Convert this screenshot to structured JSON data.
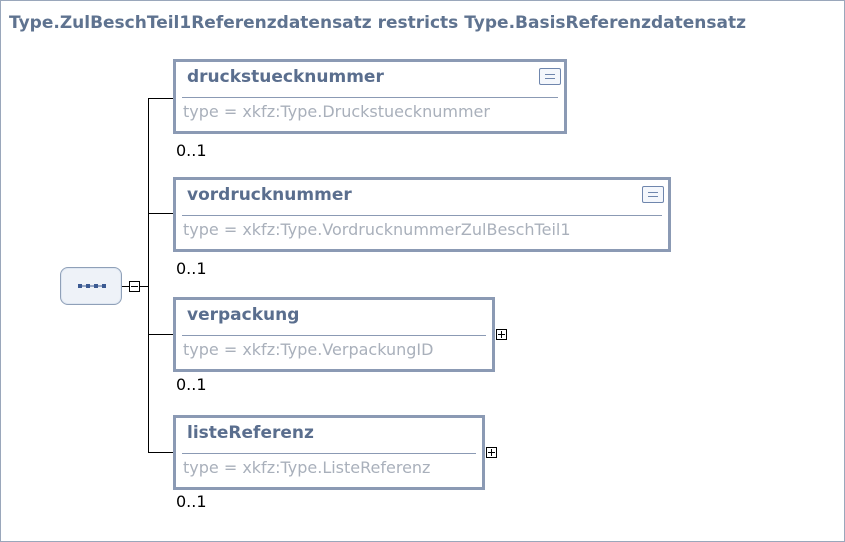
{
  "title": "Type.ZulBeschTeil1Referenzdatensatz restricts Type.BasisReferenzdatensatz",
  "elements": [
    {
      "name": "druckstuecknummer",
      "type": "type = xkfz:Type.Druckstuecknummer",
      "cardinality": "0..1",
      "has_doc": true
    },
    {
      "name": "vordrucknummer",
      "type": "type = xkfz:Type.VordrucknummerZulBeschTeil1",
      "cardinality": "0..1",
      "has_doc": true
    },
    {
      "name": "verpackung",
      "type": "type = xkfz:Type.VerpackungID",
      "cardinality": "0..1",
      "expandable": true
    },
    {
      "name": "listeReferenz",
      "type": "type = xkfz:Type.ListeReferenz",
      "cardinality": "0..1",
      "expandable": true
    }
  ],
  "icons": {
    "sequence": "sequence-compositor-icon",
    "collapse": "minus-toggle-icon",
    "expand": "plus-toggle-icon",
    "documentation": "documentation-icon"
  },
  "colors": {
    "title": "#5f7390",
    "box_border": "#8b9ab4",
    "element_name": "#5a6e8e",
    "type_text": "#a9b0bb"
  }
}
